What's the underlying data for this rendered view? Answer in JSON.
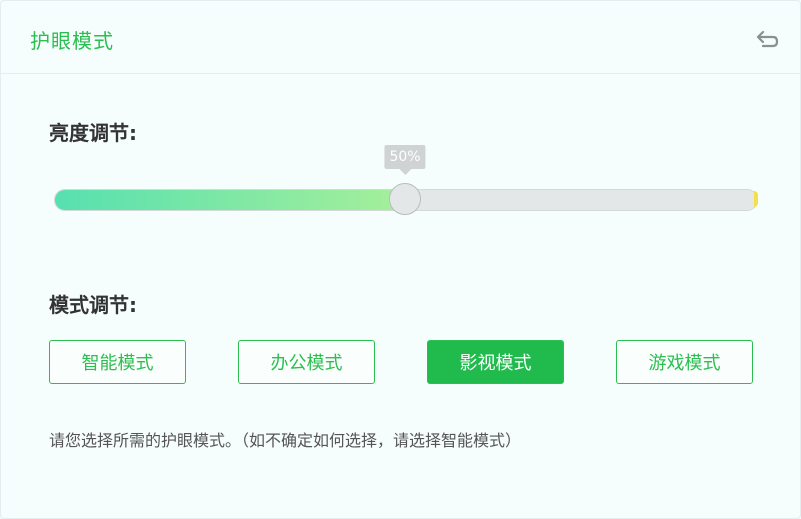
{
  "header": {
    "title": "护眼模式",
    "reset_icon": "undo-icon"
  },
  "brightness": {
    "label": "亮度调节:",
    "value_percent": 50,
    "value_text": "50%"
  },
  "mode": {
    "label": "模式调节:",
    "options": [
      "智能模式",
      "办公模式",
      "影视模式",
      "游戏模式"
    ],
    "selected": "影视模式"
  },
  "hint": "请您选择所需的护眼模式。（如不确定如何选择，请选择智能模式）",
  "colors": {
    "accent": "#2bbf4f",
    "gradient_start": "#57e0b0",
    "gradient_end": "#a6ef9a"
  }
}
